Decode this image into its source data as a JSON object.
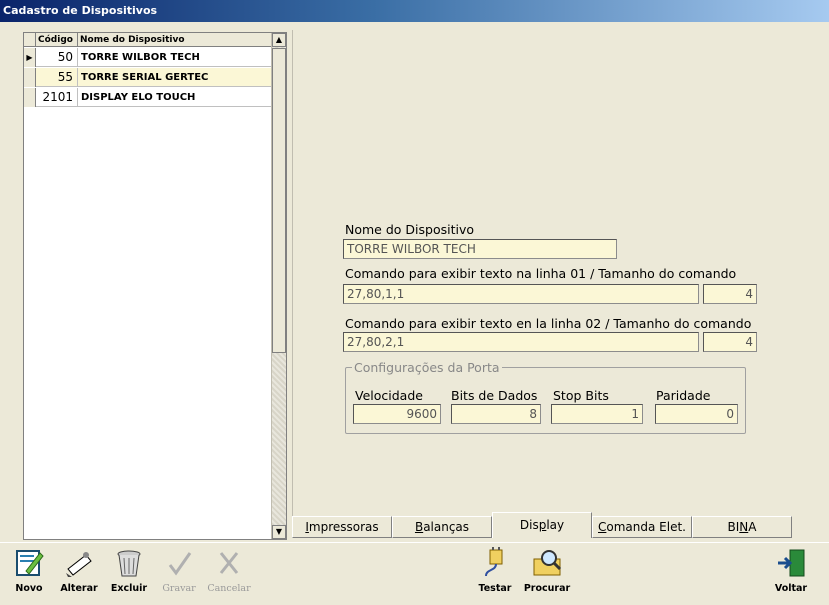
{
  "window": {
    "title": "Cadastro de Dispositivos"
  },
  "grid": {
    "headers": {
      "code": "Código",
      "name": "Nome do Dispositivo"
    },
    "rows": [
      {
        "code": "50",
        "name": "TORRE WILBOR TECH",
        "current": true
      },
      {
        "code": "55",
        "name": "TORRE SERIAL GERTEC"
      },
      {
        "code": "2101",
        "name": "DISPLAY ELO TOUCH"
      }
    ],
    "indicator": "▶"
  },
  "form": {
    "device_name_label": "Nome do Dispositivo",
    "device_name_value": "TORRE WILBOR TECH",
    "line1_label": "Comando para exibir texto na linha 01 / Tamanho do comando",
    "line1_command": "27,80,1,1",
    "line1_size": "4",
    "line2_label": "Comando para exibir texto en la linha 02 / Tamanho do comando",
    "line2_command": "27,80,2,1",
    "line2_size": "4",
    "port": {
      "legend": "Configurações da Porta",
      "speed_label": "Velocidade",
      "speed_value": "9600",
      "databits_label": "Bits de Dados",
      "databits_value": "8",
      "stopbits_label": "Stop Bits",
      "stopbits_value": "1",
      "parity_label": "Paridade",
      "parity_value": "0"
    }
  },
  "tabs": [
    {
      "label_u": "I",
      "label_rest": "mpressoras",
      "active": false
    },
    {
      "label_u": "B",
      "label_rest": "alanças",
      "active": false
    },
    {
      "label_pre": "Dis",
      "label_u": "p",
      "label_rest": "lay",
      "active": true
    },
    {
      "label_u": "C",
      "label_rest": "omanda Elet.",
      "active": false
    },
    {
      "label_pre": "BI",
      "label_u": "N",
      "label_rest": "A",
      "active": false
    }
  ],
  "toolbar": {
    "novo": "Novo",
    "alterar": "Alterar",
    "excluir": "Excluir",
    "gravar": "Gravar",
    "cancelar": "Cancelar",
    "testar": "Testar",
    "procurar": "Procurar",
    "voltar": "Voltar"
  },
  "colors": {
    "field_bg": "#fbf7d6",
    "title_start": "#0a246a",
    "title_end": "#a6caf0"
  }
}
